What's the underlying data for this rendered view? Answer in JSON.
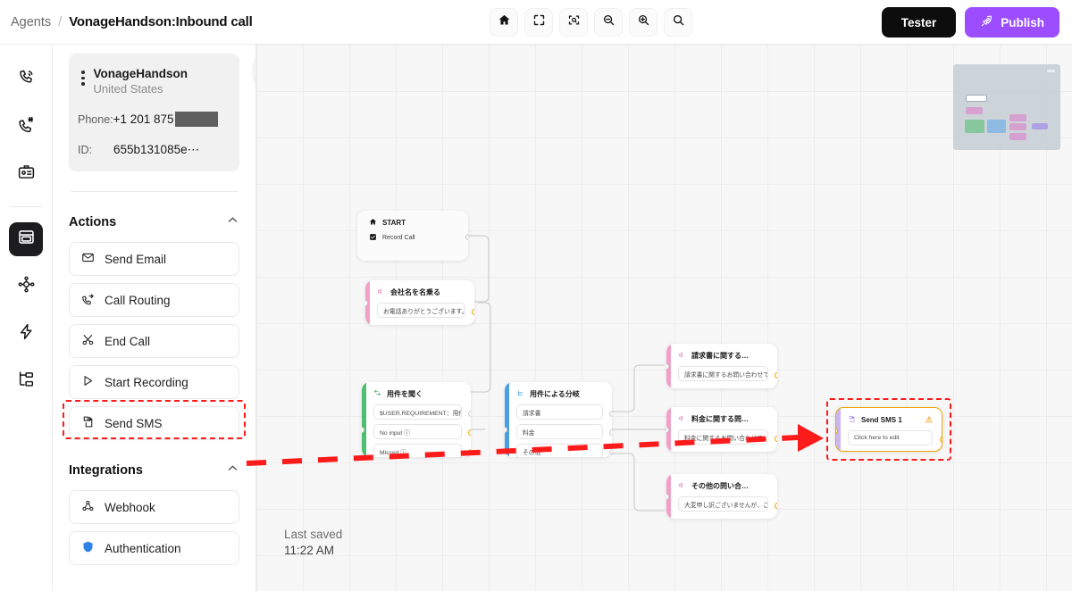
{
  "header": {
    "breadcrumb_root": "Agents",
    "breadcrumb_sep": "/",
    "breadcrumb_title": "VonageHandson:Inbound call",
    "tools": [
      {
        "name": "home-icon",
        "label": "Home"
      },
      {
        "name": "fullscreen-icon",
        "label": "Fullscreen"
      },
      {
        "name": "fit-to-view-icon",
        "label": "Fit to view"
      },
      {
        "name": "zoom-out-icon",
        "label": "Zoom out"
      },
      {
        "name": "zoom-in-icon",
        "label": "Zoom in"
      },
      {
        "name": "search-icon",
        "label": "Search"
      }
    ],
    "tester_label": "Tester",
    "publish_label": "Publish",
    "publish_color": "#9b4dff",
    "tester_color": "#0d0d0d"
  },
  "rail": {
    "items": [
      {
        "name": "phone-ringing-icon",
        "label": "Calls",
        "active": false
      },
      {
        "name": "phone-number-icon",
        "label": "Numbers",
        "active": false
      },
      {
        "name": "id-card-icon",
        "label": "Contacts",
        "active": false
      },
      {
        "name": "canvas-icon",
        "label": "Canvas",
        "active": true
      },
      {
        "name": "agent-hub-icon",
        "label": "Agents",
        "active": false
      },
      {
        "name": "lightning-icon",
        "label": "Events",
        "active": false
      },
      {
        "name": "hierarchy-icon",
        "label": "Flows",
        "active": false
      }
    ]
  },
  "sidebar": {
    "agent": {
      "name": "VonageHandson",
      "country": "United States",
      "phone_label": "Phone:",
      "phone_value": "+1 201 875",
      "phone_redacted": true,
      "id_label": "ID:",
      "id_value": "655b131085e⋯"
    },
    "lock_icon": "lock-icon",
    "sections": [
      {
        "title": "Actions",
        "collapse_icon": "chevron-up-icon",
        "items": [
          {
            "label": "Send Email",
            "icon": "envelope-icon",
            "highlighted": false
          },
          {
            "label": "Call Routing",
            "icon": "call-routing-icon",
            "highlighted": false
          },
          {
            "label": "End Call",
            "icon": "scissors-icon",
            "highlighted": false
          },
          {
            "label": "Start Recording",
            "icon": "play-icon",
            "highlighted": false
          },
          {
            "label": "Send SMS",
            "icon": "sms-icon",
            "highlighted": true
          }
        ]
      },
      {
        "title": "Integrations",
        "collapse_icon": "chevron-up-icon",
        "items": [
          {
            "label": "Webhook",
            "icon": "webhook-icon",
            "highlighted": false
          },
          {
            "label": "Authentication",
            "icon": "auth-icon",
            "highlighted": false
          }
        ]
      }
    ]
  },
  "canvas": {
    "last_saved_label": "Last saved",
    "last_saved_time": "11:22 AM",
    "highlight_color": "#fb1b1b",
    "nodes": [
      {
        "id": "start",
        "title": "START",
        "title_icon": "home-icon",
        "accent": "#f0f0f0",
        "fields": [
          {
            "text": "Record Call",
            "icon": "check-square-icon"
          }
        ]
      },
      {
        "id": "greeting",
        "title": "会社名を名乗る",
        "title_icon": "speaker-icon",
        "accent": "#f2a0c8",
        "fields": [
          {
            "text": "お電話ありがとうございます。…"
          }
        ]
      },
      {
        "id": "ask-requirement",
        "title": "用件を聞く",
        "title_icon": "question-icon",
        "accent": "#4cbf73",
        "fields": [
          {
            "text": "$USER.REQUIREMENT：用件を聞く"
          },
          {
            "text": "No input ⓘ"
          },
          {
            "text": "Missed ⓘ"
          }
        ]
      },
      {
        "id": "branch",
        "title": "用件による分岐",
        "title_icon": "branch-icon",
        "accent": "#4a9fe0",
        "fields": [
          {
            "text": "請求書"
          },
          {
            "text": "料金"
          },
          {
            "text": "その他"
          }
        ]
      },
      {
        "id": "invoice",
        "title": "請求書に関する…",
        "title_icon": "speaker-icon",
        "accent": "#f2a0c8",
        "fields": [
          {
            "text": "請求書に関するお問い合わせで…"
          }
        ]
      },
      {
        "id": "pricing",
        "title": "料金に関する問…",
        "title_icon": "speaker-icon",
        "accent": "#f2a0c8",
        "fields": [
          {
            "text": "料金に関するお問い合わせで…"
          }
        ]
      },
      {
        "id": "other",
        "title": "その他の問い合…",
        "title_icon": "speaker-icon",
        "accent": "#f2a0c8",
        "fields": [
          {
            "text": "大変申し訳ございませんが、こ…"
          }
        ]
      },
      {
        "id": "send-sms-1",
        "title": "Send SMS 1",
        "title_icon": "sms-icon",
        "accent": "#c9b6f5",
        "warning": "⚠",
        "selected": true,
        "highlighted": true,
        "fields": [
          {
            "text": "Click here to edit"
          }
        ]
      }
    ],
    "minimap": {
      "name": "minimap",
      "close_icon": "minimap-close-icon"
    }
  }
}
